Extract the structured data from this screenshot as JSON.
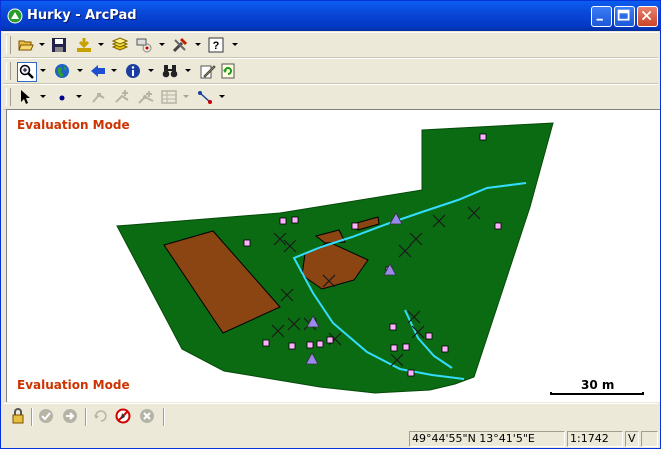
{
  "window": {
    "title": "Hurky - ArcPad"
  },
  "map": {
    "watermark_top": "Evaluation Mode",
    "watermark_bottom": "Evaluation Mode",
    "scale_label": "30 m"
  },
  "colors": {
    "vegetation": "#0b6b12",
    "soil": "#8b4513",
    "path": "#33ddff",
    "point": "#ffb0ff",
    "triangle": "#9988ee",
    "watermark": "#cc3300"
  },
  "toolbars": {
    "row1": [
      "open-folder-icon",
      "save-icon",
      "add-data-icon",
      "layers-icon",
      "gps-icon",
      "tools-icon",
      "help-icon"
    ],
    "row2": [
      "zoom-in-icon",
      "globe-icon",
      "back-arrow-icon",
      "info-icon",
      "binoculars-icon",
      "edit-pencil-icon",
      "refresh-icon"
    ],
    "row3": [
      "select-pointer-icon",
      "point-icon",
      "vertex-icon",
      "move-vertex-icon",
      "add-vertex-icon",
      "table-icon",
      "line-edit-icon"
    ],
    "bottom": [
      "lock-icon",
      "accept-icon",
      "forward-icon",
      "undo-icon",
      "cancel-edit-icon",
      "delete-icon"
    ]
  },
  "status": {
    "coordinates": "49°44'55\"N 13°41'5\"E",
    "scale": "1:1742",
    "mode": "V"
  }
}
